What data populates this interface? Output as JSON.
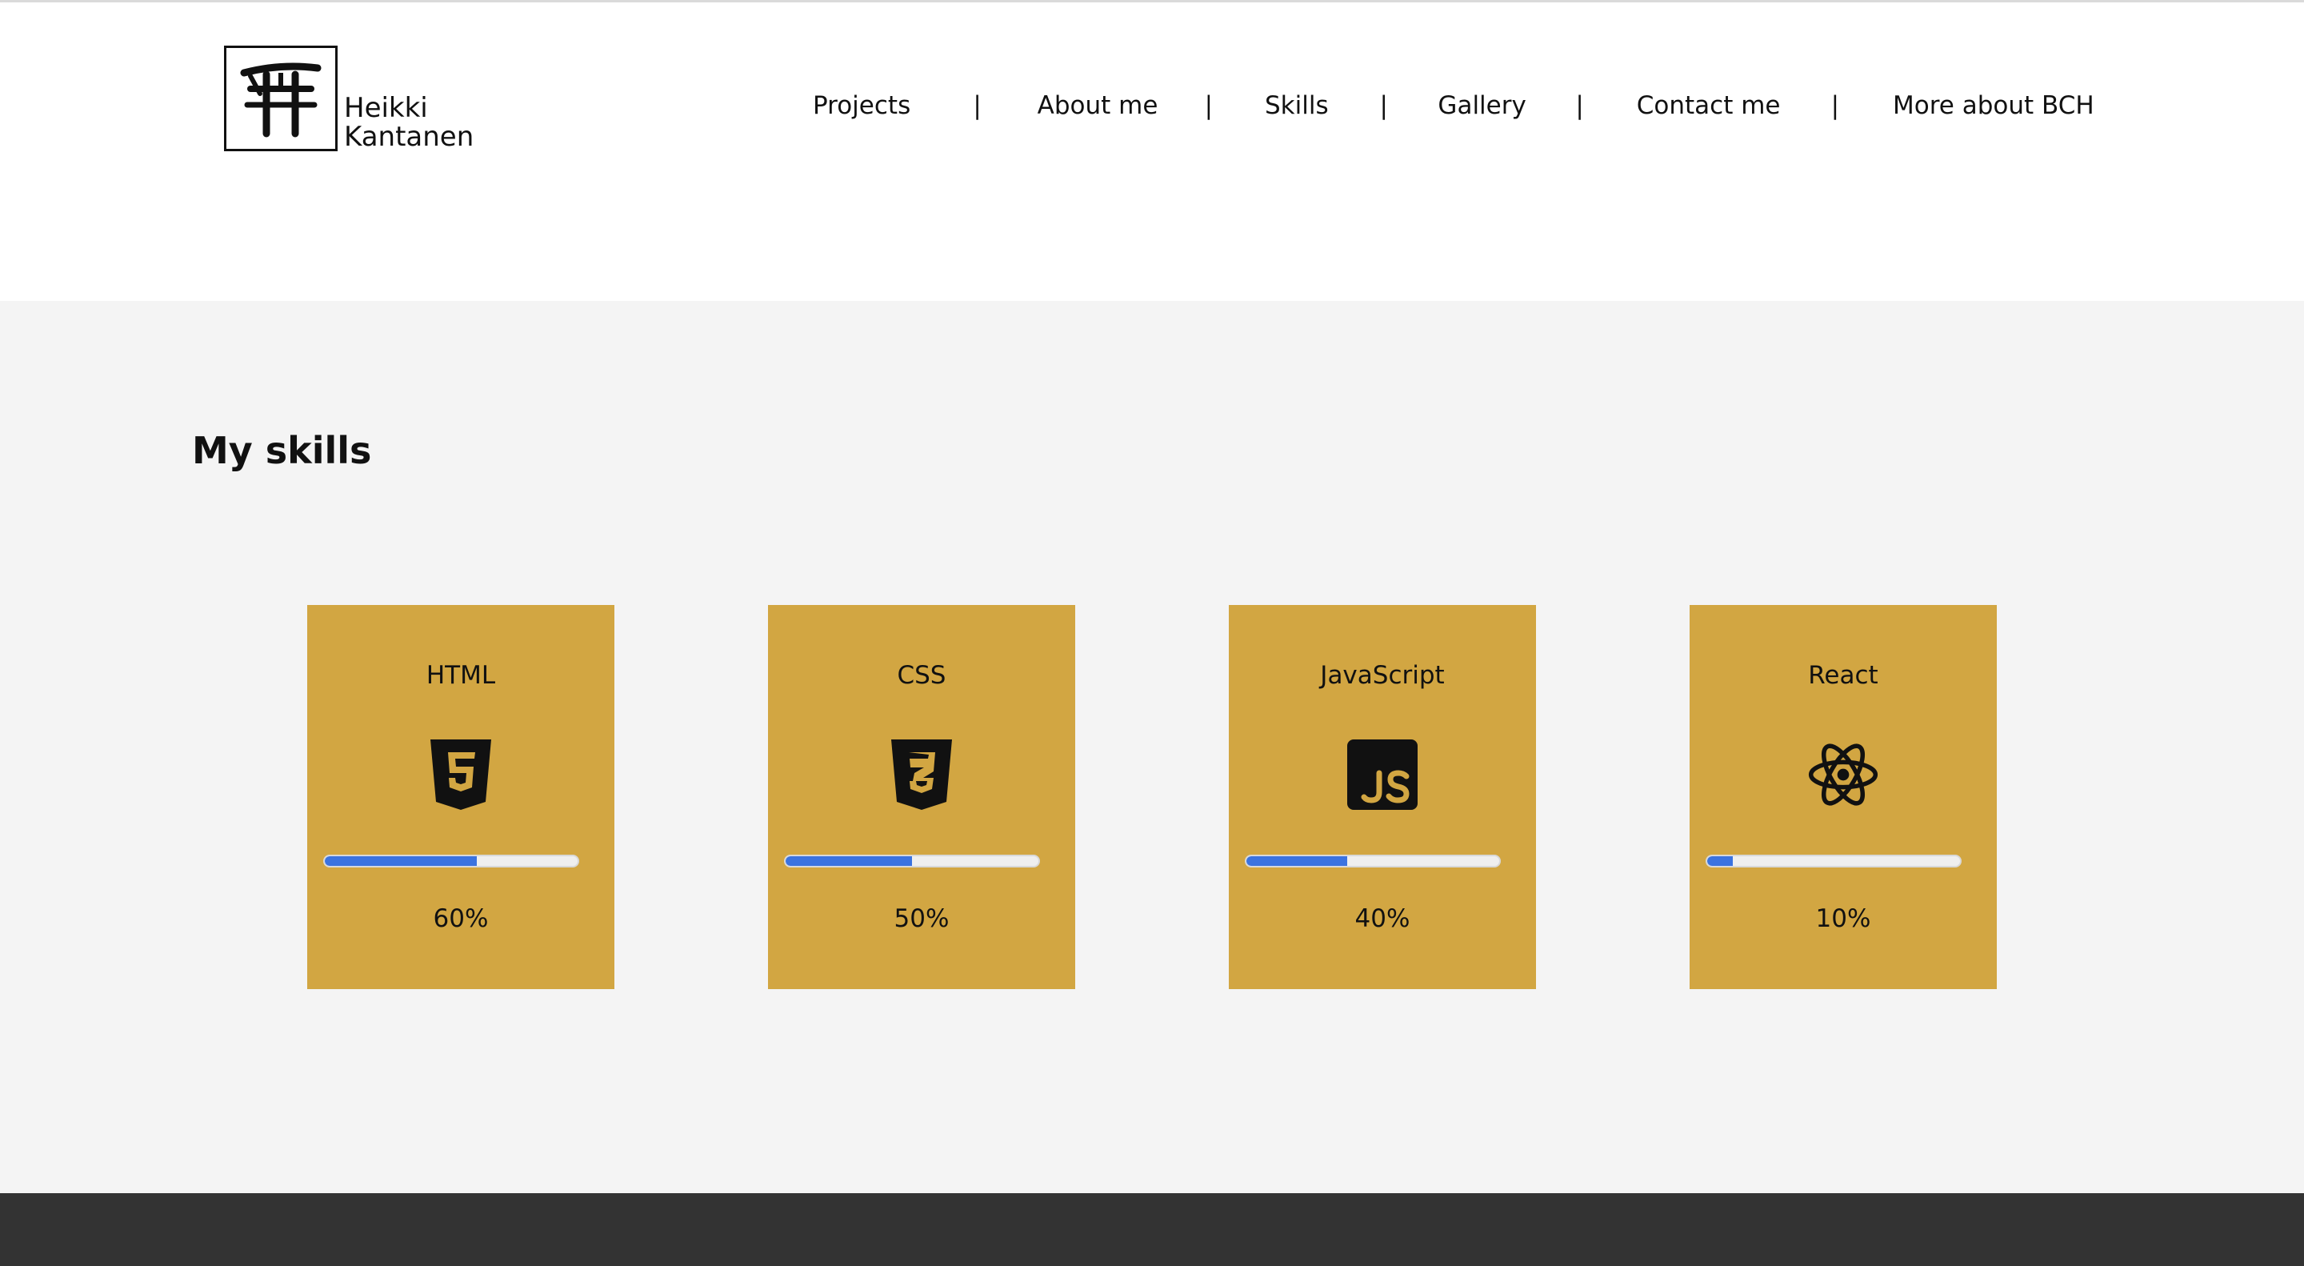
{
  "brand": {
    "name_line1": "Heikki",
    "name_line2": "Kantanen",
    "logo_icon": "torii-gate-icon"
  },
  "nav": {
    "items": [
      "Projects",
      "About me",
      "Skills",
      "Gallery",
      "Contact me",
      "More about BCH"
    ],
    "separator": "|"
  },
  "skills": {
    "title": "My skills",
    "cards": [
      {
        "label": "HTML",
        "icon": "html5-icon",
        "progress": 0.6,
        "percent_text": "60%"
      },
      {
        "label": "CSS",
        "icon": "css3-icon",
        "progress": 0.5,
        "percent_text": "50%"
      },
      {
        "label": "JavaScript",
        "icon": "javascript-icon",
        "progress": 0.4,
        "percent_text": "40%"
      },
      {
        "label": "React",
        "icon": "react-icon",
        "progress": 0.1,
        "percent_text": "10%"
      }
    ]
  },
  "colors": {
    "card_bg": "#d2a642",
    "progress_fill": "#3b73e0",
    "section_bg": "#f4f4f4",
    "footer_bg": "#333333"
  }
}
